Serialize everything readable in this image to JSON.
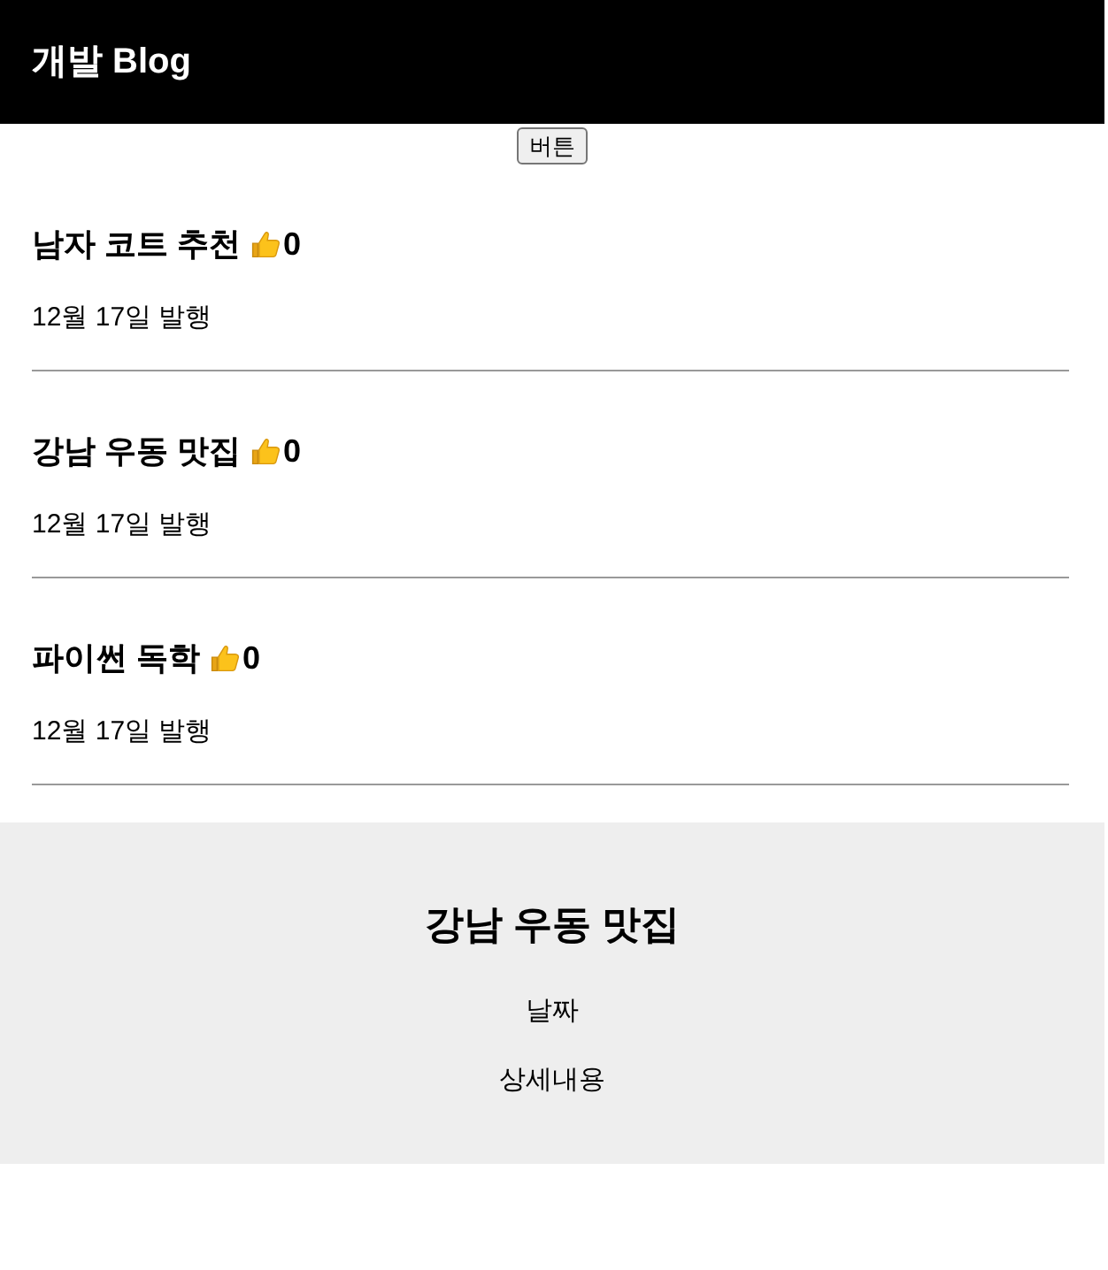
{
  "nav": {
    "title": "개발 Blog"
  },
  "button": {
    "label": "버튼"
  },
  "posts": [
    {
      "title": "남자 코트 추천",
      "likes": "0",
      "date": "12월 17일 발행"
    },
    {
      "title": "강남 우동 맛집",
      "likes": "0",
      "date": "12월 17일 발행"
    },
    {
      "title": "파이썬 독학",
      "likes": "0",
      "date": "12월 17일 발행"
    }
  ],
  "modal": {
    "title": "강남 우동 맛집",
    "date": "날짜",
    "content": "상세내용"
  }
}
